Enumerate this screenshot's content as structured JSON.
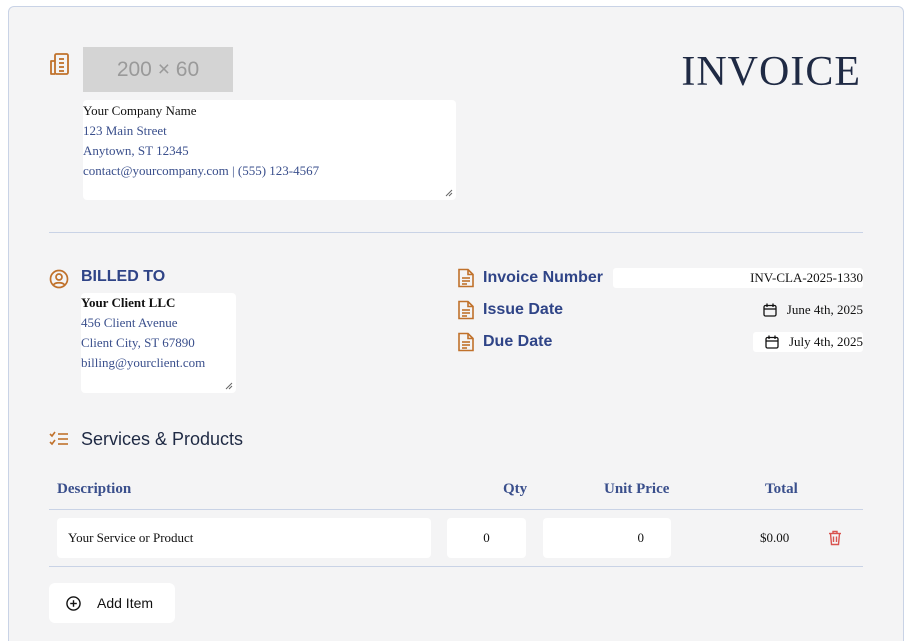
{
  "header": {
    "logo_placeholder": "200 × 60",
    "title": "INVOICE"
  },
  "company": {
    "lines": [
      "Your Company Name",
      "123 Main Street",
      "Anytown, ST 12345",
      "contact@yourcompany.com | (555) 123-4567"
    ]
  },
  "billed_to": {
    "label": "BILLED TO",
    "lines": [
      "Your Client LLC",
      "456 Client Avenue",
      "Client City, ST 67890",
      "billing@yourclient.com"
    ]
  },
  "meta": {
    "invoice_number_label": "Invoice Number",
    "invoice_number": "INV-CLA-2025-1330",
    "issue_date_label": "Issue Date",
    "issue_date": "June 4th, 2025",
    "due_date_label": "Due Date",
    "due_date": "July 4th, 2025"
  },
  "services": {
    "title": "Services & Products",
    "columns": [
      "Description",
      "Qty",
      "Unit Price",
      "Total"
    ],
    "rows": [
      {
        "description": "Your Service or Product",
        "qty": "0",
        "unit_price": "0",
        "total": "$0.00"
      }
    ],
    "add_label": "Add Item"
  },
  "colors": {
    "accent_icon": "#c0712b",
    "label_blue": "#2f4487",
    "delete_red": "#d9534f"
  },
  "icons": [
    "building-icon",
    "user-circle-icon",
    "document-icon",
    "calendar-icon",
    "checklist-icon",
    "trash-icon",
    "plus-circle-icon"
  ]
}
